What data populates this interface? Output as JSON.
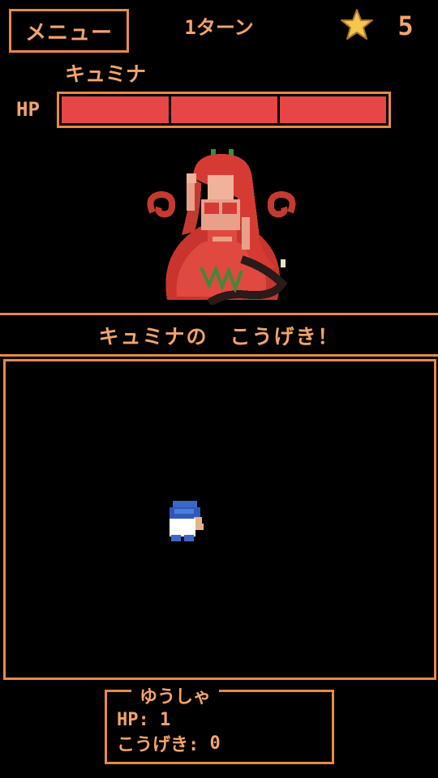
{
  "header": {
    "menu_label": "メニュー",
    "turn_label": "1ターン",
    "star_icon": "star-icon",
    "star_count": "5"
  },
  "enemy": {
    "name": "キュミナ",
    "hp_label": "HP",
    "hp_segments_total": 3,
    "hp_segments_remaining": 3,
    "sprite_icon": "plant-woman-monster-sprite"
  },
  "battle": {
    "message": "キュミナの　こうげき！"
  },
  "field": {
    "hero_icon": "hero-sprite"
  },
  "status": {
    "title": "ゆうしゃ",
    "hp_label": "HP:",
    "hp_value": "1",
    "attack_label": "こうげき:",
    "attack_value": "0"
  },
  "colors": {
    "accent": "#e98a45",
    "text": "#f4a46a",
    "hp_bar": "#e64646",
    "background": "#000000",
    "star": "#f5c64a"
  }
}
